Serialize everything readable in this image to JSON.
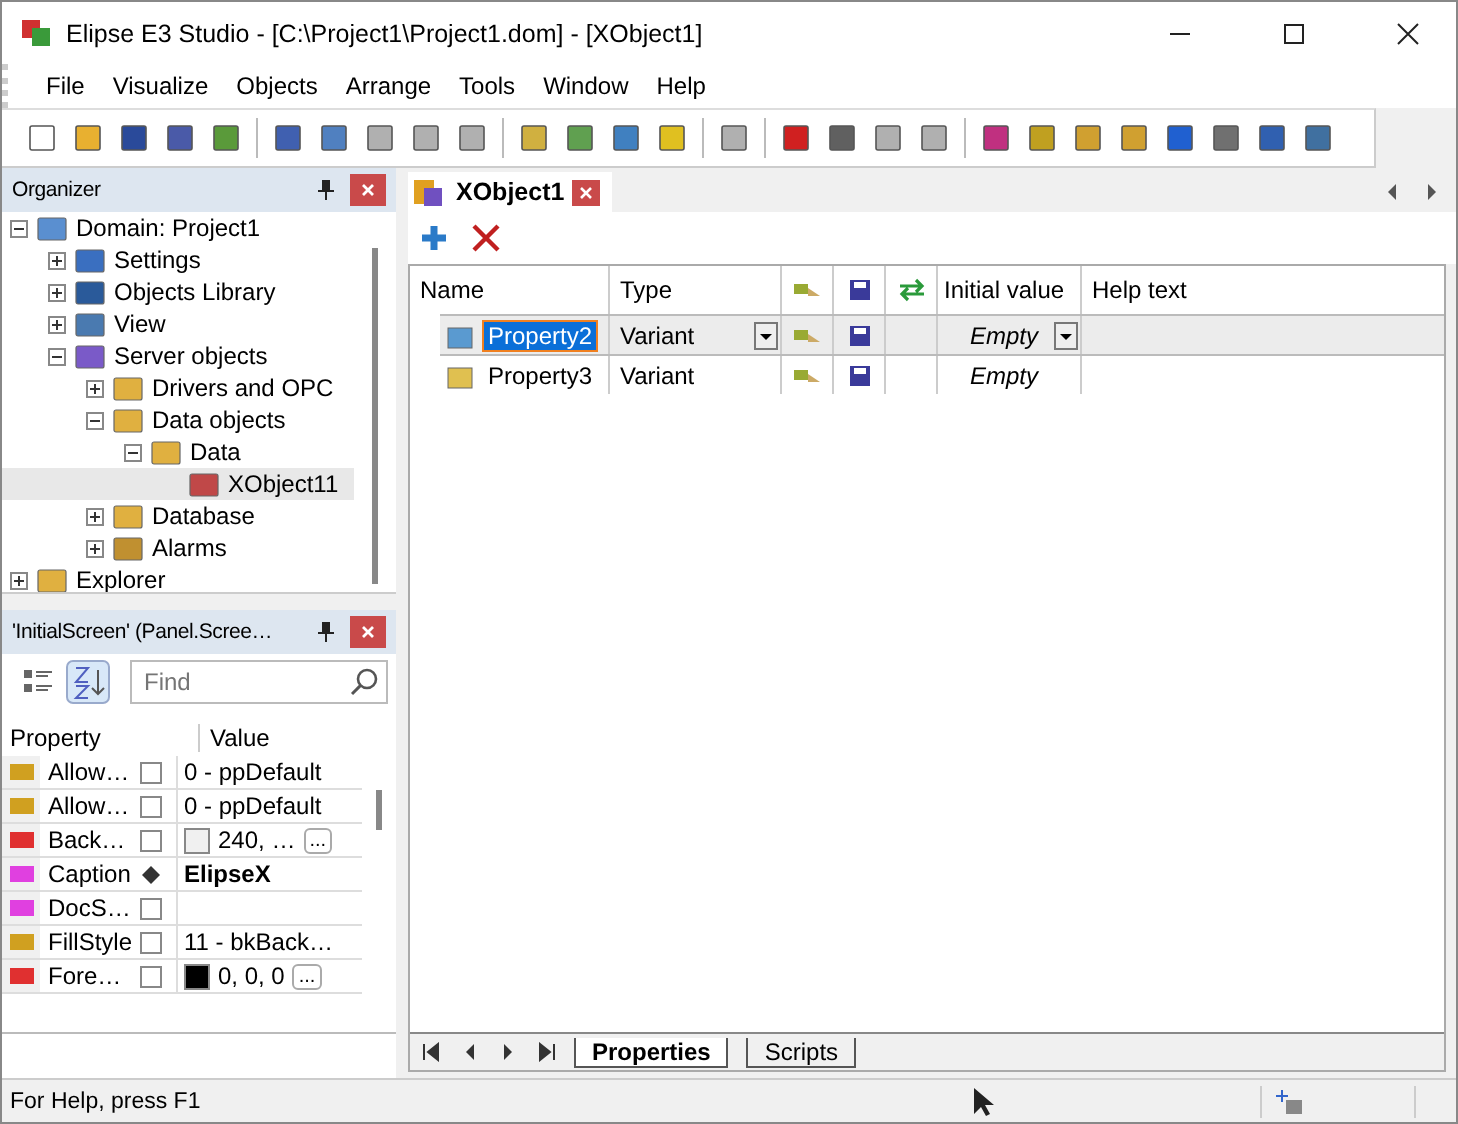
{
  "window": {
    "title": "Elipse E3 Studio - [C:\\Project1\\Project1.dom] - [XObject1]"
  },
  "menu": [
    "File",
    "Visualize",
    "Objects",
    "Arrange",
    "Tools",
    "Window",
    "Help"
  ],
  "organizer": {
    "title": "Organizer",
    "tree": [
      {
        "label": "Domain: Project1",
        "expanded": true,
        "selected": false,
        "children": [
          {
            "label": "Settings",
            "expanded": false,
            "selected": false
          },
          {
            "label": "Objects Library",
            "expanded": false,
            "selected": false
          },
          {
            "label": "View",
            "expanded": false,
            "selected": false
          },
          {
            "label": "Server objects",
            "expanded": true,
            "selected": false,
            "children": [
              {
                "label": "Drivers and OPC",
                "expanded": false,
                "selected": false
              },
              {
                "label": "Data objects",
                "expanded": true,
                "selected": false,
                "children": [
                  {
                    "label": "Data",
                    "expanded": true,
                    "selected": false,
                    "children": [
                      {
                        "label": "XObject11",
                        "selected": true
                      }
                    ]
                  }
                ]
              },
              {
                "label": "Database",
                "expanded": false,
                "selected": false
              },
              {
                "label": "Alarms",
                "expanded": false,
                "selected": false
              }
            ]
          }
        ]
      },
      {
        "label": "Explorer",
        "expanded": false,
        "selected": false
      }
    ]
  },
  "properties_panel": {
    "title": "'InitialScreen' (Panel.Scree…",
    "search": {
      "placeholder": "Find"
    },
    "columns": [
      "Property",
      "Value"
    ],
    "rows": [
      {
        "kind": "enum",
        "name": "Allow…",
        "modified": false,
        "value": "0 - ppDefault"
      },
      {
        "kind": "enum",
        "name": "Allow…",
        "modified": false,
        "value": "0 - ppDefault"
      },
      {
        "kind": "color",
        "name": "Back…",
        "modified": false,
        "value": "240, …",
        "color": "#f0f0f0",
        "button": "..."
      },
      {
        "kind": "text",
        "name": "Caption",
        "modified": true,
        "value": "ElipseX"
      },
      {
        "kind": "text",
        "name": "DocS…",
        "modified": false
      },
      {
        "kind": "enum",
        "name": "FillStyle",
        "modified": false,
        "value": "11 - bkBack…"
      },
      {
        "kind": "color",
        "name": "Fore…",
        "modified": false,
        "value": "0, 0, 0",
        "color": "#000000",
        "button": "..."
      }
    ]
  },
  "document": {
    "tab": {
      "label": "XObject1",
      "selected": true
    },
    "columns": [
      "Name",
      "Type",
      "Initial value",
      "Help text"
    ],
    "rows": [
      {
        "name": "Property2",
        "type": "Variant",
        "initial_value": "Empty",
        "selected": true
      },
      {
        "name": "Property3",
        "type": "Variant",
        "initial_value": "Empty",
        "selected": false
      }
    ],
    "bottom_tabs": [
      {
        "label": "Properties",
        "selected": true
      },
      {
        "label": "Scripts",
        "selected": false
      }
    ]
  },
  "status_bar": {
    "text": "For Help, press F1"
  }
}
